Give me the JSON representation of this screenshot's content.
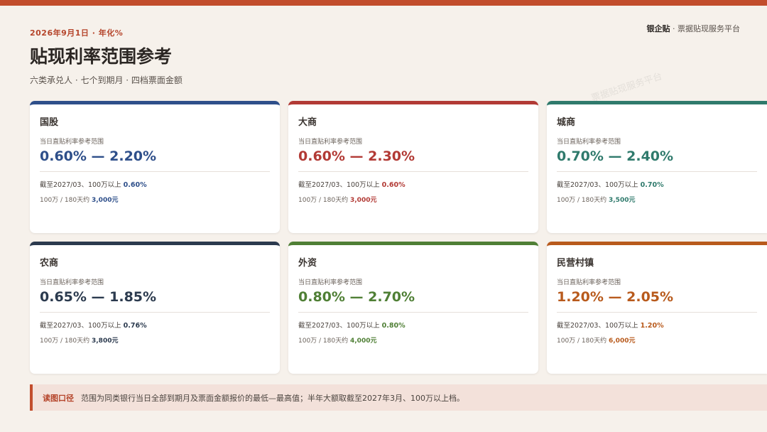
{
  "header": {
    "date": "2026年9月1日 · 年化%",
    "title": "贴现利率范围参考",
    "subtitle": "六类承兑人 · 七个到期月 · 四档票面金额",
    "brand_name": "银企贴",
    "brand_tail": "· 票据贴现服务平台",
    "watermark": "票据贴现服务平台"
  },
  "common": {
    "range_label": "当日直贴利率参考范围",
    "line1_prefix": "截至2027/03、100万以上",
    "line2_prefix": "100万 / 180天约"
  },
  "cards": [
    {
      "name": "国股",
      "range": "0.60% — 2.20%",
      "rate": "0.60%",
      "amount": "3,000元",
      "color": "#2e4f8a"
    },
    {
      "name": "大商",
      "range": "0.60% — 2.30%",
      "rate": "0.60%",
      "amount": "3,000元",
      "color": "#b23a35"
    },
    {
      "name": "城商",
      "range": "0.70% — 2.40%",
      "rate": "0.70%",
      "amount": "3,500元",
      "color": "#2f7a6c"
    },
    {
      "name": "农商",
      "range": "0.65% — 1.85%",
      "rate": "0.76%",
      "amount": "3,800元",
      "color": "#2b3a4e"
    },
    {
      "name": "外资",
      "range": "0.80% — 2.70%",
      "rate": "0.80%",
      "amount": "4,000元",
      "color": "#4f7f35"
    },
    {
      "name": "民营村镇",
      "range": "1.20% — 2.05%",
      "rate": "1.20%",
      "amount": "6,000元",
      "color": "#b85a1c"
    }
  ],
  "note": {
    "label": "读图口径",
    "text": "范围为同类银行当日全部到期月及票面金额报价的最低—最高值；半年大额取截至2027年3月、100万以上档。"
  }
}
